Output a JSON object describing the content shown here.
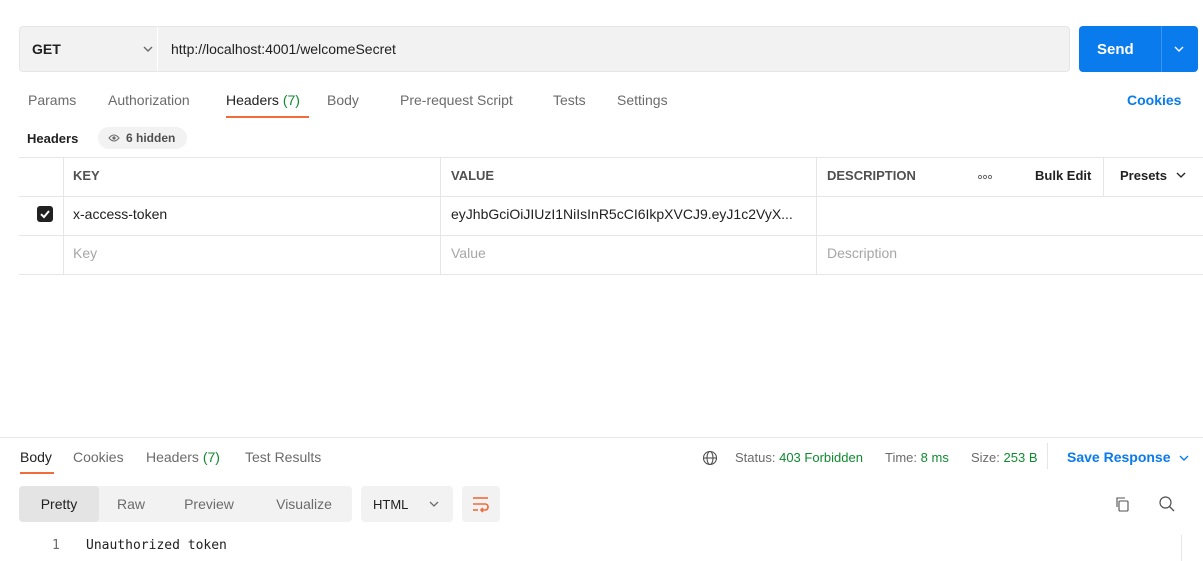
{
  "request": {
    "method": "GET",
    "url": "http://localhost:4001/welcomeSecret",
    "send_label": "Send"
  },
  "request_tabs": {
    "params": "Params",
    "authorization": "Authorization",
    "headers": "Headers",
    "headers_count": "(7)",
    "body": "Body",
    "pre_request_script": "Pre-request Script",
    "tests": "Tests",
    "settings": "Settings",
    "active": "Headers",
    "cookies": "Cookies"
  },
  "headers_section": {
    "label": "Headers",
    "hidden_badge": "6 hidden"
  },
  "headers_table": {
    "columns": {
      "key": "KEY",
      "value": "VALUE",
      "description": "DESCRIPTION",
      "bulk_edit": "Bulk Edit",
      "presets": "Presets"
    },
    "rows": [
      {
        "checked": true,
        "key": "x-access-token",
        "value": "eyJhbGciOiJIUzI1NiIsInR5cCI6IkpXVCJ9.eyJ1c2VyX...",
        "description": ""
      }
    ],
    "placeholders": {
      "key": "Key",
      "value": "Value",
      "description": "Description"
    }
  },
  "response": {
    "tabs": {
      "body": "Body",
      "cookies": "Cookies",
      "headers": "Headers",
      "headers_count": "(7)",
      "test_results": "Test Results",
      "active": "Body"
    },
    "status_label": "Status:",
    "status_value": "403 Forbidden",
    "time_label": "Time:",
    "time_value": "8 ms",
    "size_label": "Size:",
    "size_value": "253 B",
    "save_response": "Save Response",
    "view_modes": [
      "Pretty",
      "Raw",
      "Preview",
      "Visualize"
    ],
    "active_view": "Pretty",
    "format": "HTML",
    "lines": [
      {
        "number": "1",
        "text": "Unauthorized token"
      }
    ]
  },
  "colors": {
    "accent_blue": "#097bed",
    "active_tab_underline": "#f26b3a",
    "success_green": "#0f8a30"
  },
  "icons": [
    "chevron-down-icon",
    "eye-icon",
    "check-icon",
    "more-horizontal-icon",
    "globe-icon",
    "wrap-lines-icon",
    "copy-icon",
    "search-icon"
  ]
}
